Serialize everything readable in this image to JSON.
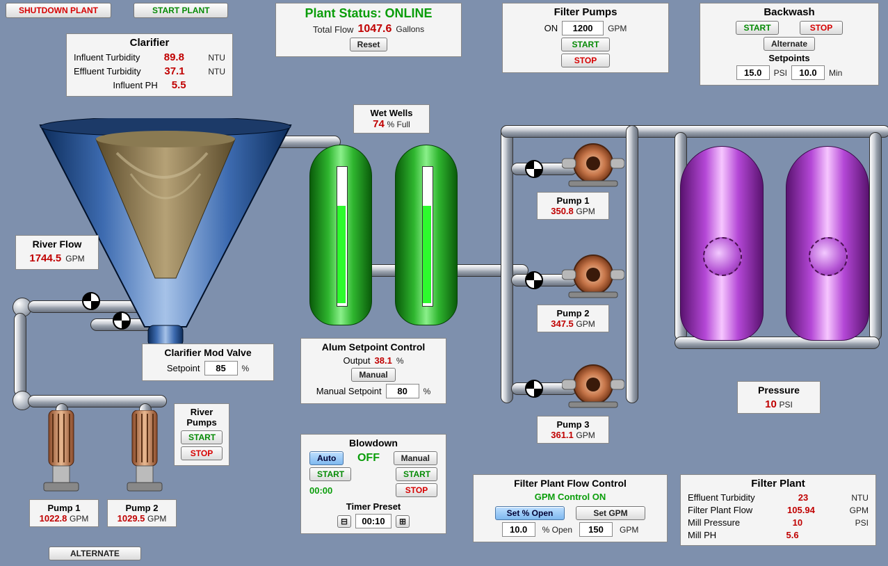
{
  "controls": {
    "shutdown_label": "SHUTDOWN PLANT",
    "start_label": "START PLANT",
    "alternate_label": "ALTERNATE"
  },
  "plant_status": {
    "title": "Plant Status: ONLINE",
    "total_flow_label": "Total Flow",
    "total_flow_value": "1047.6",
    "total_flow_unit": "Gallons",
    "reset_label": "Reset"
  },
  "clarifier": {
    "title": "Clarifier",
    "rows": [
      {
        "label": "Influent Turbidity",
        "value": "89.8",
        "unit": "NTU"
      },
      {
        "label": "Effluent Turbidity",
        "value": "37.1",
        "unit": "NTU"
      },
      {
        "label": "Influent PH",
        "value": "5.5",
        "unit": ""
      }
    ]
  },
  "river_flow": {
    "title": "River Flow",
    "value": "1744.5",
    "unit": "GPM"
  },
  "clar_mod_valve": {
    "title": "Clarifier Mod Valve",
    "setpoint_label": "Setpoint",
    "setpoint": "85",
    "unit": "%"
  },
  "river_pumps": {
    "title": "River Pumps",
    "start": "START",
    "stop": "STOP",
    "p1_label": "Pump 1",
    "p1_value": "1022.8",
    "p1_unit": "GPM",
    "p2_label": "Pump 2",
    "p2_value": "1029.5",
    "p2_unit": "GPM"
  },
  "wet_wells": {
    "title": "Wet Wells",
    "value": "74",
    "unit": "% Full"
  },
  "alum": {
    "title": "Alum Setpoint Control",
    "output_label": "Output",
    "output": "38.1",
    "output_unit": "%",
    "manual_label": "Manual",
    "manual_sp_label": "Manual Setpoint",
    "manual_sp": "80",
    "manual_sp_unit": "%"
  },
  "blowdown": {
    "title": "Blowdown",
    "auto": "Auto",
    "manual": "Manual",
    "state": "OFF",
    "start": "START",
    "stop": "STOP",
    "timer": "00:00",
    "preset_label": "Timer Preset",
    "preset": "00:10"
  },
  "filter_pumps": {
    "title": "Filter Pumps",
    "on_label": "ON",
    "on_value": "1200",
    "on_unit": "GPM",
    "start": "START",
    "stop": "STOP",
    "p1_label": "Pump 1",
    "p1_value": "350.8",
    "p2_label": "Pump 2",
    "p2_value": "347.5",
    "p3_label": "Pump 3",
    "p3_value": "361.1",
    "unit": "GPM"
  },
  "backwash": {
    "title": "Backwash",
    "start": "START",
    "stop": "STOP",
    "alternate": "Alternate",
    "setpoints_label": "Setpoints",
    "psi_val": "15.0",
    "psi_unit": "PSI",
    "min_val": "10.0",
    "min_unit": "Min"
  },
  "pressure": {
    "title": "Pressure",
    "value": "10",
    "unit": "PSI"
  },
  "flow_control": {
    "title": "Filter Plant Flow Control",
    "status": "GPM Control ON",
    "set_open": "Set % Open",
    "set_gpm": "Set GPM",
    "open_val": "10.0",
    "open_unit": "% Open",
    "gpm_val": "150",
    "gpm_unit": "GPM"
  },
  "filter_plant": {
    "title": "Filter Plant",
    "rows": [
      {
        "label": "Effluent Turbidity",
        "value": "23",
        "unit": "NTU"
      },
      {
        "label": "Filter Plant Flow",
        "value": "105.94",
        "unit": "GPM"
      },
      {
        "label": "Mill Pressure",
        "value": "10",
        "unit": "PSI"
      },
      {
        "label": "Mill PH",
        "value": "5.6",
        "unit": ""
      }
    ]
  }
}
